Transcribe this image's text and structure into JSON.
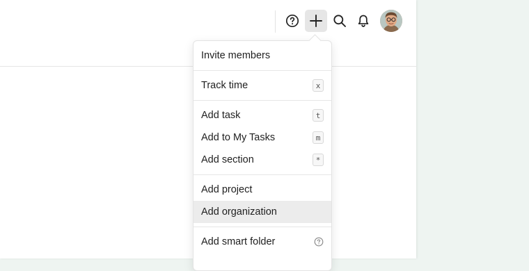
{
  "topbar": {
    "icons": [
      "help-icon",
      "plus-icon",
      "search-icon",
      "bell-icon",
      "avatar"
    ]
  },
  "menu": {
    "groups": [
      {
        "items": [
          {
            "label": "Invite members",
            "shortcut": ""
          }
        ]
      },
      {
        "items": [
          {
            "label": "Track time",
            "shortcut": "x"
          }
        ]
      },
      {
        "items": [
          {
            "label": "Add task",
            "shortcut": "t"
          },
          {
            "label": "Add to My Tasks",
            "shortcut": "m"
          },
          {
            "label": "Add section",
            "shortcut": "*"
          }
        ]
      },
      {
        "items": [
          {
            "label": "Add project",
            "shortcut": ""
          },
          {
            "label": "Add organization",
            "shortcut": ""
          }
        ]
      },
      {
        "items": [
          {
            "label": "Add smart folder",
            "shortcut": ""
          }
        ]
      }
    ]
  },
  "colors": {
    "background": "#eef4f1",
    "panel": "#ffffff",
    "hover": "#ececec"
  }
}
